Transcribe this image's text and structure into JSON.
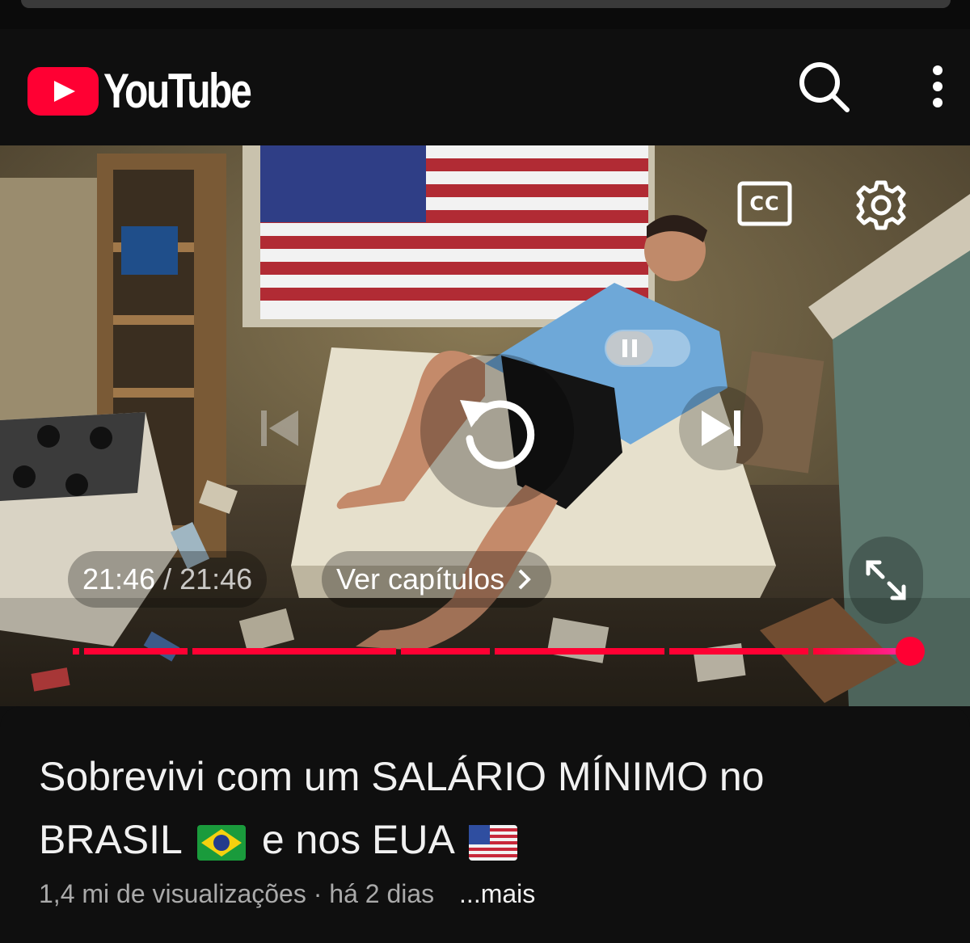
{
  "header": {
    "logo_text": "YouTube",
    "icons": {
      "search": "search-icon",
      "more": "more-vert-icon"
    }
  },
  "player": {
    "current_time": "21:46",
    "separator": "/",
    "duration": "21:46",
    "chapters_label": "Ver capítulos",
    "progress_fraction": 1.0,
    "controls": {
      "autoplay": "pause-toggle-icon",
      "captions": "closed-captions-icon",
      "captions_text": "CC",
      "settings": "gear-icon",
      "previous": "skip-previous-icon",
      "replay": "replay-icon",
      "next": "skip-next-icon",
      "fullscreen": "fullscreen-icon"
    },
    "accent_color": "#ff0033"
  },
  "video": {
    "title_line1": "Sobrevivi com um SALÁRIO MÍNIMO no",
    "title_line2_a": "BRASIL",
    "title_line2_b": "e nos EUA",
    "views": "1,4 mi de visualizações",
    "dot": "·",
    "age": "há 2 dias",
    "more_label": "...mais"
  }
}
